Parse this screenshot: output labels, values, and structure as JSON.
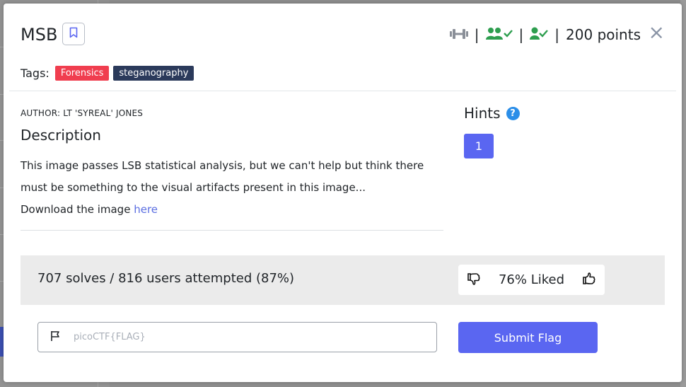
{
  "challenge": {
    "title": "MSB",
    "points_label": "200 points",
    "close_symbol": "×"
  },
  "tags": {
    "label": "Tags:",
    "items": [
      {
        "text": "Forensics",
        "color": "#f03e4f"
      },
      {
        "text": "steganography",
        "color": "#2b3a5b"
      }
    ]
  },
  "description": {
    "author": "AUTHOR: LT 'SYREAL' JONES",
    "heading": "Description",
    "body": "This image passes LSB statistical analysis, but we can't help but think there must be something to the visual artifacts present in this image...",
    "download_prefix": "Download the image ",
    "download_link": "here"
  },
  "hints": {
    "heading": "Hints",
    "help_symbol": "?",
    "buttons": [
      "1"
    ]
  },
  "stats": {
    "solves_text": "707 solves / 816 users attempted (87%)",
    "liked_text": "76% Liked"
  },
  "flag": {
    "placeholder": "picoCTF{FLAG}",
    "submit_label": "Submit Flag"
  },
  "icons": {
    "difficulty": "dumbbell-icon",
    "team_solved": "users-check-icon",
    "user_solved": "user-check-icon",
    "bookmark": "bookmark-icon",
    "flag": "flag-icon",
    "thumbs_down": "thumbs-down-icon",
    "thumbs_up": "thumbs-up-icon"
  },
  "colors": {
    "accent": "#5a66f1",
    "success": "#2e9e4f",
    "link": "#5b6ee1",
    "help": "#2b8ee8"
  }
}
